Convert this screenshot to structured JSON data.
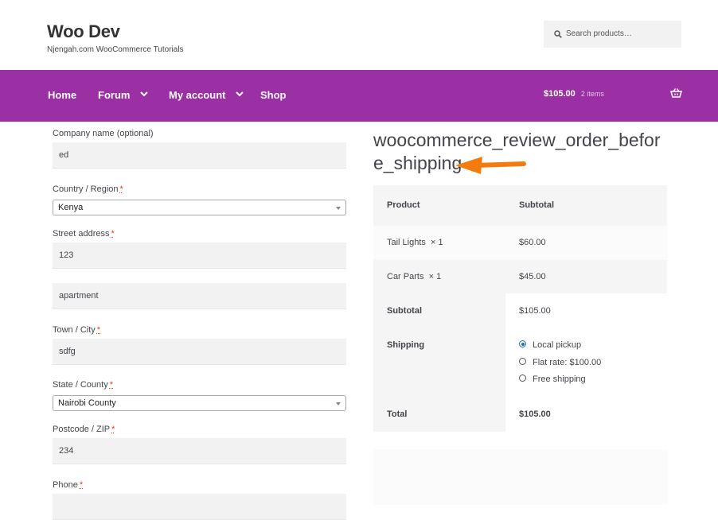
{
  "header": {
    "site_title": "Woo Dev",
    "site_description": "Njengah.com WooCommerce Tutorials",
    "search_placeholder": "Search products…"
  },
  "nav": {
    "items": [
      {
        "label": "Home",
        "has_dropdown": false
      },
      {
        "label": "Forum",
        "has_dropdown": true
      },
      {
        "label": "My account",
        "has_dropdown": true
      },
      {
        "label": "Shop",
        "has_dropdown": false
      }
    ],
    "cart_total": "$105.00",
    "cart_count": "2 items",
    "bg_color": "#9b30a4"
  },
  "billing": {
    "company_label": "Company name (optional)",
    "company_value": "ed",
    "country_label": "Country / Region",
    "country_value": "Kenya",
    "street_label": "Street address",
    "street_value": "123",
    "street2_value": "apartment",
    "town_label": "Town / City",
    "town_value": "sdfg",
    "state_label": "State / County",
    "state_value": "Nairobi County",
    "postcode_label": "Postcode / ZIP",
    "postcode_value": "234",
    "phone_label": "Phone",
    "required_mark": "*"
  },
  "review": {
    "hook_title": "woocommerce_review_order_before_shipping",
    "headers": {
      "product": "Product",
      "subtotal": "Subtotal"
    },
    "items": [
      {
        "name": "Tail Lights",
        "qty": "× 1",
        "price": "$60.00"
      },
      {
        "name": "Car Parts",
        "qty": "× 1",
        "price": "$45.00"
      }
    ],
    "subtotal_label": "Subtotal",
    "subtotal_value": "$105.00",
    "shipping_label": "Shipping",
    "shipping_options": [
      {
        "label": "Local pickup",
        "selected": true
      },
      {
        "label": "Flat rate: $100.00",
        "selected": false
      },
      {
        "label": "Free shipping",
        "selected": false
      }
    ],
    "total_label": "Total",
    "total_value": "$105.00",
    "arrow_color": "#f47c0f"
  }
}
